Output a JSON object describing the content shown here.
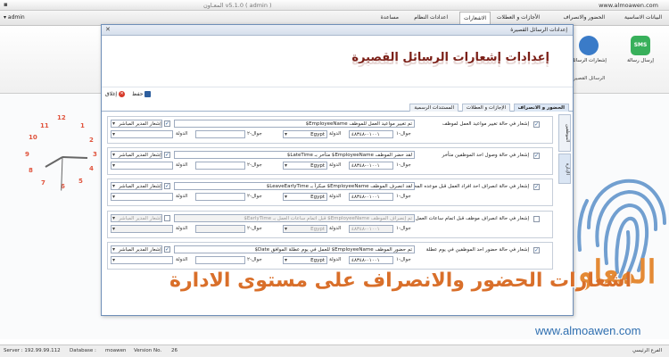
{
  "window": {
    "title": "v5.1.0 ( admin )",
    "title_ar": "المعـاون",
    "website": "www.almoawen.com"
  },
  "menu": {
    "user": "admin",
    "tabs": [
      "البيانات الاساسية",
      "الحضور والانصراف",
      "الأجازات و العطلات",
      "الاشعارات",
      "اعدادات النظام",
      "مساعدة"
    ],
    "active_tab": "الاشعارات"
  },
  "ribbon": {
    "send_sms": "إرسال رسالة",
    "sms_label": "SMS",
    "sms_notifications": "إشعارات الرسائل",
    "group_label": "الرسائل القصيرة"
  },
  "dialog": {
    "title": "إعدادات الرسائل القصيرة",
    "header": "إعدادات إشعارات الرسائل القصيرة",
    "toolbar": {
      "save": "حفظ",
      "close": "إغلاق"
    },
    "tabs": [
      "الحضور و الانصراف",
      "الإجازات و العطلات",
      "المستندات الرسمية"
    ],
    "active_tab": "الحضور و الانصراف",
    "vtabs": [
      "الموظفين",
      "الإدارة"
    ],
    "field_labels": {
      "country_label": "الدولة",
      "mobile_label": "جوال-١",
      "mobile2_label": "جوال-٢",
      "manager_label": "إشعار المدير المباشر",
      "country_value": "Egypt",
      "mobile_value": "٠١٠٠١-٤٨٣٤٨"
    },
    "rows": [
      {
        "label": "إشعار في حالة تغيير مواعيد العمل لموظف",
        "message": "تم تغيير مواعيد العمل للموظف EmployeeName$",
        "checked": true,
        "manager_checked": true
      },
      {
        "label": "إشعار في حالة وصول احد الموظفين متأخر",
        "message": "لقد حضر الموظف EmployeeName$ متأخر بـ LateTime$",
        "checked": true,
        "manager_checked": true
      },
      {
        "label": "إشعار في حالة انصراف احد افراد العمل قبل موعده المحدد",
        "message": "لقد انصرف الموظف EmployeeName$ مبكراً بـ LeaveEarlyTime$",
        "checked": true,
        "manager_checked": true
      },
      {
        "label": "إشعار في حالة انصراف موظف قبل اتمام ساعات العمل",
        "message": "تم إنصراف الموظف EmployeeName$ قبل اتمام ساعات العمل بـ EarlyTime$",
        "checked": false,
        "manager_checked": false
      },
      {
        "label": "إشعار في حالة حضور احد الموظفين في يوم عطلة",
        "message": "تم حضور الموظف EmployeeName$ للعمل في يوم عطلة الموافق Date$",
        "checked": true,
        "manager_checked": true
      }
    ]
  },
  "clock": [
    "12",
    "1",
    "2",
    "3",
    "4",
    "5",
    "6",
    "7",
    "8",
    "9",
    "10",
    "11"
  ],
  "brand": {
    "name_ar": "المعاو",
    "url": "www.almoawen.com",
    "caption": "اشعارات الحضور والانصراف على مستوى الادارة"
  },
  "status": {
    "server": "Server : 192.99.99.112",
    "database": "Database :",
    "db_name": "moawen",
    "version_label": "Version No.",
    "version": "26",
    "branch": "الفرع الرئيسي"
  },
  "colors": {
    "accent": "#7b1f17",
    "brand_orange": "#e48a35",
    "link_blue": "#2f6fb0",
    "sms_green": "#38b05b"
  }
}
